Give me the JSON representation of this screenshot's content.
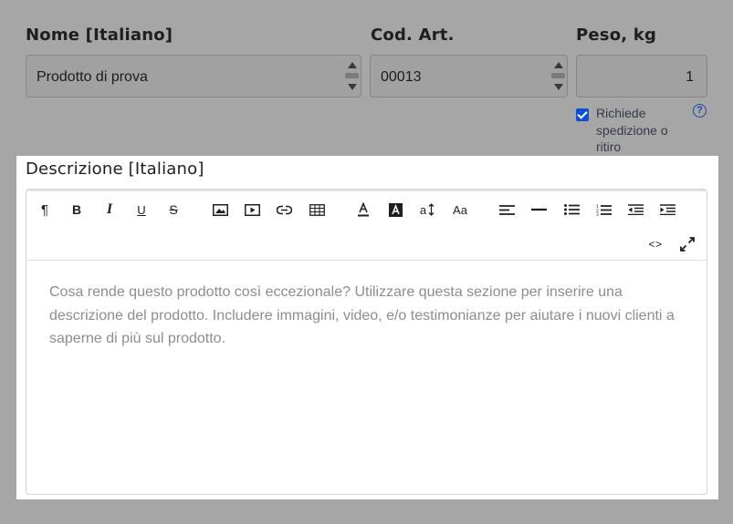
{
  "fields": {
    "name": {
      "label": "Nome [Italiano]",
      "value": "Prodotto di prova"
    },
    "sku": {
      "label": "Cod. Art.",
      "value": "00013"
    },
    "weight": {
      "label": "Peso, kg",
      "value": "1"
    }
  },
  "shipping": {
    "checked": true,
    "label": "Richiede spedizione o ritiro",
    "help_glyph": "?"
  },
  "description": {
    "label": "Descrizione [Italiano]",
    "placeholder": "Cosa rende questo prodotto così eccezionale? Utilizzare questa sezione per inserire una descrizione del prodotto. Includere immagini, video, e/o testimonianze per aiutare i nuovi clienti a saperne di più sul prodotto."
  },
  "toolbar": {
    "paragraph_glyph": "¶",
    "bold_glyph": "B",
    "italic_glyph": "I",
    "underline_glyph": "U",
    "strike_glyph": "S",
    "font_size_glyph": "a",
    "case_glyph": "Aa",
    "code_glyph": "<>",
    "icons": [
      "paragraph-icon",
      "bold-icon",
      "italic-icon",
      "underline-icon",
      "strikethrough-icon",
      "image-icon",
      "video-icon",
      "link-icon",
      "table-icon",
      "text-color-icon",
      "background-color-icon",
      "font-size-icon",
      "text-case-icon",
      "align-left-icon",
      "horizontal-rule-icon",
      "bullet-list-icon",
      "numbered-list-icon",
      "outdent-icon",
      "indent-icon",
      "code-view-icon",
      "fullscreen-icon"
    ]
  },
  "colors": {
    "overlay_bg": "#a6a6a6",
    "checkbox": "#0b4fd6",
    "help": "#1a47a8",
    "placeholder": "#8d8d8d"
  }
}
